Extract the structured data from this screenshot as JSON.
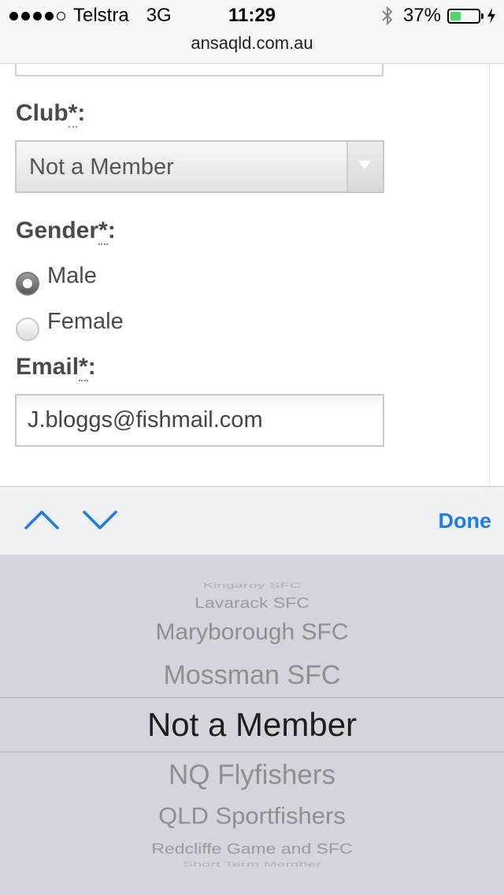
{
  "status_bar": {
    "carrier": "Telstra",
    "network": "3G",
    "time": "11:29",
    "battery_percent": "37%",
    "battery_level": 0.37,
    "battery_color": "#4cd964",
    "url": "ansaqld.com.au"
  },
  "form": {
    "club_label": "Club",
    "required_mark": "*",
    "colon": ":",
    "club_value": "Not a Member",
    "gender_label": "Gender",
    "gender_options": [
      {
        "label": "Male",
        "checked": true
      },
      {
        "label": "Female",
        "checked": false
      }
    ],
    "email_label": "Email",
    "email_value": "J.bloggs@fishmail.com"
  },
  "toolbar": {
    "prev_icon": "chevron-up-icon",
    "next_icon": "chevron-down-icon",
    "done_label": "Done",
    "accent_color": "#1a7cf2"
  },
  "picker": {
    "items": [
      "Kingaroy SFC",
      "Lavarack SFC",
      "Maryborough SFC",
      "Mossman SFC",
      "Not a Member",
      "NQ Flyfishers",
      "QLD Sportfishers",
      "Redcliffe Game and SFC",
      "Short Term Member"
    ],
    "selected": "Not a Member"
  }
}
